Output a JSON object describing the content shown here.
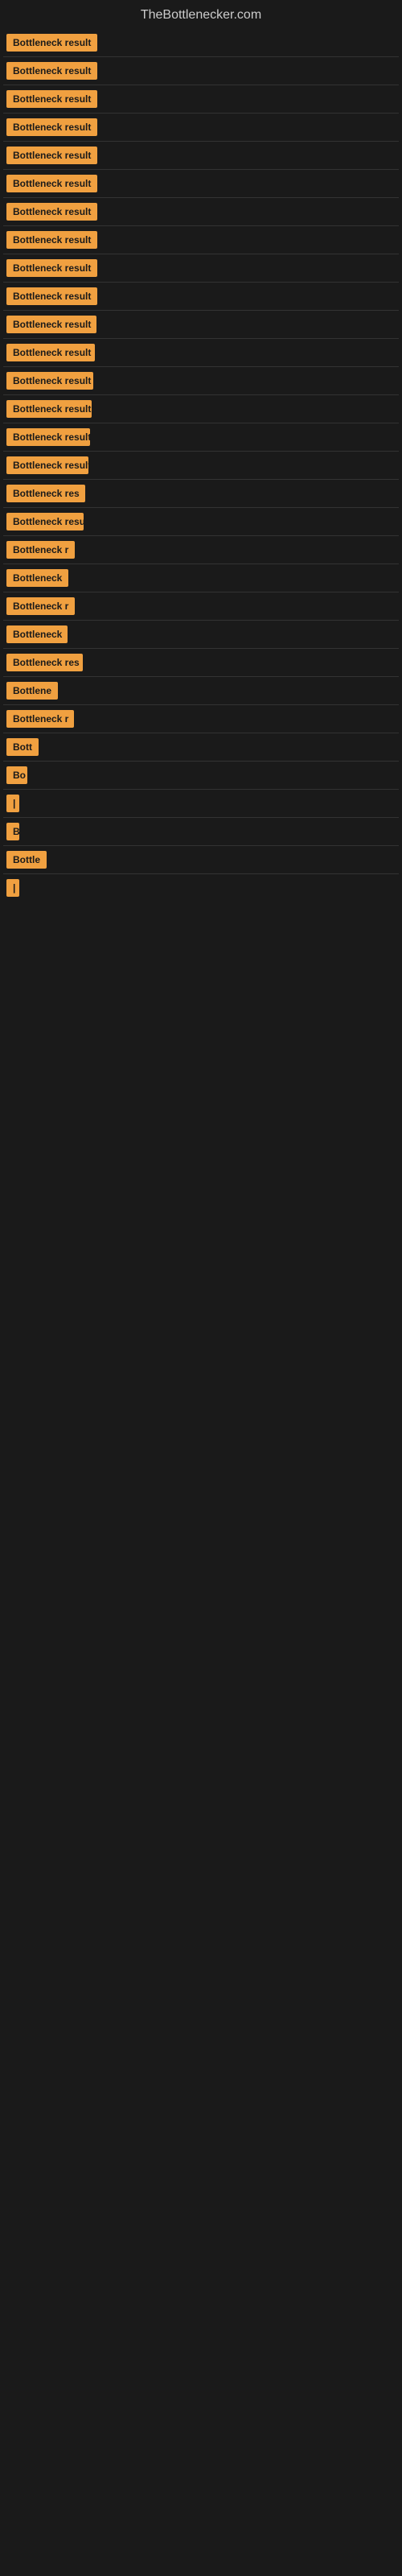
{
  "site": {
    "title": "TheBottlenecker.com"
  },
  "items": [
    {
      "label": "Bottleneck result",
      "width": 130
    },
    {
      "label": "Bottleneck result",
      "width": 130
    },
    {
      "label": "Bottleneck result",
      "width": 128
    },
    {
      "label": "Bottleneck result",
      "width": 126
    },
    {
      "label": "Bottleneck result",
      "width": 124
    },
    {
      "label": "Bottleneck result",
      "width": 122
    },
    {
      "label": "Bottleneck result",
      "width": 120
    },
    {
      "label": "Bottleneck result",
      "width": 118
    },
    {
      "label": "Bottleneck result",
      "width": 116
    },
    {
      "label": "Bottleneck result",
      "width": 114
    },
    {
      "label": "Bottleneck result",
      "width": 112
    },
    {
      "label": "Bottleneck result",
      "width": 110
    },
    {
      "label": "Bottleneck result",
      "width": 108
    },
    {
      "label": "Bottleneck result",
      "width": 106
    },
    {
      "label": "Bottleneck result",
      "width": 104
    },
    {
      "label": "Bottleneck result",
      "width": 102
    },
    {
      "label": "Bottleneck res",
      "width": 98
    },
    {
      "label": "Bottleneck result",
      "width": 96
    },
    {
      "label": "Bottleneck r",
      "width": 88
    },
    {
      "label": "Bottleneck",
      "width": 78
    },
    {
      "label": "Bottleneck r",
      "width": 86
    },
    {
      "label": "Bottleneck",
      "width": 76
    },
    {
      "label": "Bottleneck res",
      "width": 95
    },
    {
      "label": "Bottlene",
      "width": 68
    },
    {
      "label": "Bottleneck r",
      "width": 84
    },
    {
      "label": "Bott",
      "width": 42
    },
    {
      "label": "Bo",
      "width": 26
    },
    {
      "label": "|",
      "width": 8
    },
    {
      "label": "B",
      "width": 14
    },
    {
      "label": "Bottle",
      "width": 50
    },
    {
      "label": "|",
      "width": 6
    }
  ]
}
